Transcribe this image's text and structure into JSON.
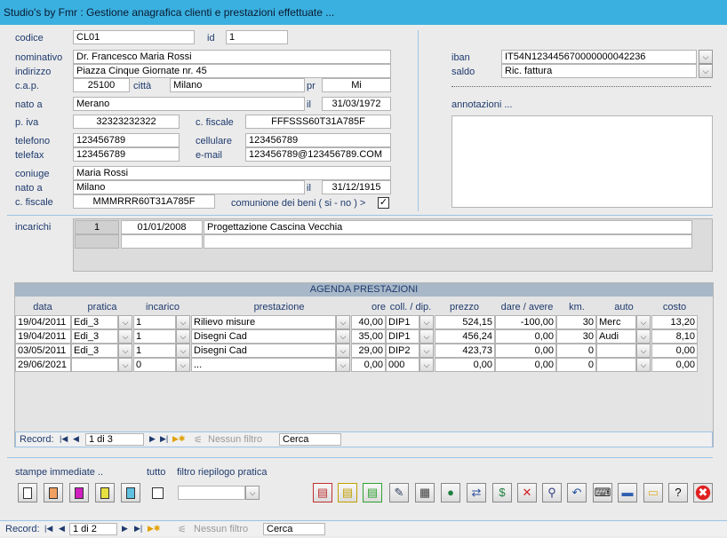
{
  "window": {
    "title": "Studio's by Fmr : Gestione anagrafica clienti e prestazioni effettuate ..."
  },
  "client": {
    "codice_label": "codice",
    "codice": "CL01",
    "id_label": "id",
    "id": "1",
    "nominativo_label": "nominativo",
    "nominativo": "Dr. Francesco Maria Rossi",
    "indirizzo_label": "indirizzo",
    "indirizzo": "Piazza Cinque Giornate nr. 45",
    "cap_label": "c.a.p.",
    "cap": "25100",
    "citta_label": "città",
    "citta": "Milano",
    "pr_label": "pr",
    "pr": "Mi",
    "nato_a_label": "nato a",
    "nato_a": "Merano",
    "il_label": "il",
    "il": "31/03/1972",
    "piva_label": "p. iva",
    "piva": "32323232322",
    "cfiscale_label": "c. fiscale",
    "cfiscale": "FFFSSS60T31A785F",
    "telefono_label": "telefono",
    "telefono": "123456789",
    "cellulare_label": "cellulare",
    "cellulare": "123456789",
    "telefax_label": "telefax",
    "telefax": "123456789",
    "email_label": "e-mail",
    "email": "123456789@123456789.COM",
    "coniuge_label": "coniuge",
    "coniuge": "Maria Rossi",
    "con_nato_a_label": "nato a",
    "con_nato_a": "Milano",
    "con_il_label": "il",
    "con_il": "31/12/1915",
    "con_cf_label": "c. fiscale",
    "con_cf": "MMMRRR60T31A785F",
    "comunione_label": "comunione dei beni ( si - no )  >",
    "comunione_checked": "✓",
    "iban_label": "iban",
    "iban": "IT54N123445670000000042236",
    "saldo_label": "saldo",
    "saldo": "Ric. fattura",
    "annotazioni_label": "annotazioni ..."
  },
  "incarichi": {
    "label": "incarichi",
    "rows": [
      {
        "num": "1",
        "date": "01/01/2008",
        "desc": "Progettazione Cascina Vecchia"
      }
    ]
  },
  "agenda": {
    "title": "AGENDA PRESTAZIONI",
    "columns": [
      "data",
      "pratica",
      "incarico",
      "prestazione",
      "ore",
      "coll. / dip.",
      "prezzo",
      "dare / avere",
      "km.",
      "auto",
      "costo"
    ],
    "rows": [
      {
        "data": "19/04/2011",
        "pratica": "Edi_3",
        "incarico": "1",
        "prestazione": "Rilievo misure",
        "ore": "40,00",
        "coll": "DIP1",
        "prezzo": "524,15",
        "dare": "-100,00",
        "km": "30",
        "auto": "Merc",
        "costo": "13,20"
      },
      {
        "data": "19/04/2011",
        "pratica": "Edi_3",
        "incarico": "1",
        "prestazione": "Disegni Cad",
        "ore": "35,00",
        "coll": "DIP1",
        "prezzo": "456,24",
        "dare": "0,00",
        "km": "30",
        "auto": "Audi",
        "costo": "8,10"
      },
      {
        "data": "03/05/2011",
        "pratica": "Edi_3",
        "incarico": "1",
        "prestazione": "Disegni Cad",
        "ore": "29,00",
        "coll": "DIP2",
        "prezzo": "423,73",
        "dare": "0,00",
        "km": "0",
        "auto": "",
        "costo": "0,00"
      },
      {
        "data": "29/06/2021",
        "pratica": "",
        "incarico": "0",
        "prestazione": "...",
        "ore": "0,00",
        "coll": "000",
        "prezzo": "0,00",
        "dare": "0,00",
        "km": "0",
        "auto": "",
        "costo": "0,00"
      }
    ],
    "nav": {
      "record_label": "Record:",
      "position": "1 di 3",
      "filter": "Nessun filtro",
      "search": "Cerca"
    }
  },
  "footer": {
    "stampe_label": "stampe immediate ..",
    "tutto_label": "tutto",
    "filtro_label": "filtro riepilogo pratica",
    "filtro_value": "",
    "nav": {
      "record_label": "Record:",
      "position": "1 di 2",
      "filter": "Nessun filtro",
      "search": "Cerca"
    }
  },
  "toolbar_icons": [
    "report-red-icon",
    "report-yellow-icon",
    "report-green-icon",
    "edit-icon",
    "calculator-icon",
    "globe-icon",
    "transfer-icon",
    "money-icon",
    "delete-x-icon",
    "search-icon",
    "undo-icon",
    "keyboard-icon",
    "save-icon",
    "folder-icon",
    "help-icon",
    "close-red-icon"
  ],
  "print_icons": [
    "print-preview-1-icon",
    "print-preview-2-icon",
    "print-preview-3-icon",
    "print-preview-4-icon",
    "print-preview-5-icon"
  ]
}
